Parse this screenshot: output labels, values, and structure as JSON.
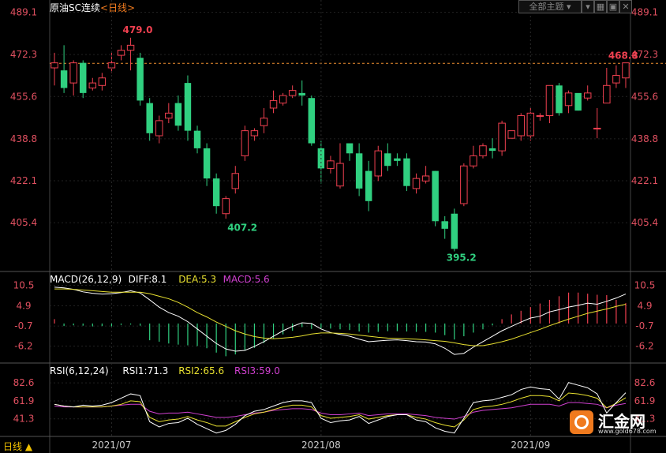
{
  "header": {
    "title": "原油SC连续",
    "period": "<日线>",
    "theme_button": "全部主题",
    "bottom_period": "日线 ▲"
  },
  "toolbar_icons": [
    "dropdown-icon",
    "grid-icon",
    "image-icon",
    "close-icon"
  ],
  "logo": {
    "text": "汇金网",
    "url": "www.gold678.com"
  },
  "chart_data": [
    {
      "type": "candlestick",
      "title": "原油SC连续 日线",
      "y_ticks": [
        "489.1",
        "472.3",
        "455.6",
        "438.8",
        "422.1",
        "405.4"
      ],
      "ylim": [
        386,
        494
      ],
      "x_ticks": [
        {
          "label": "2021/07",
          "index": 6
        },
        {
          "label": "2021/08",
          "index": 28
        },
        {
          "label": "2021/09",
          "index": 50
        }
      ],
      "last_price_line": 468.8,
      "annotations": [
        {
          "label": "479.0",
          "index": 7,
          "value": 479.0,
          "pos": "above"
        },
        {
          "label": "407.2",
          "index": 18,
          "value": 407.2,
          "pos": "below"
        },
        {
          "label": "395.2",
          "index": 41,
          "value": 395.2,
          "pos": "below"
        },
        {
          "label": "468.8",
          "index": 58,
          "value": 468.8,
          "pos": "above"
        }
      ],
      "candles": [
        [
          467,
          469,
          460,
          473
        ],
        [
          466,
          459,
          457,
          476
        ],
        [
          461,
          469,
          456,
          470
        ],
        [
          469,
          457,
          455,
          470
        ],
        [
          459,
          461,
          458,
          463
        ],
        [
          460,
          463,
          458,
          465
        ],
        [
          467,
          469,
          465,
          473
        ],
        [
          472,
          474,
          470,
          476
        ],
        [
          474,
          476,
          466,
          479
        ],
        [
          471,
          454,
          452,
          473
        ],
        [
          453,
          441,
          438,
          455
        ],
        [
          440,
          446,
          437,
          448
        ],
        [
          447,
          449,
          445,
          453
        ],
        [
          453,
          444,
          442,
          456
        ],
        [
          461,
          442,
          438,
          464
        ],
        [
          442,
          435,
          433,
          444
        ],
        [
          435,
          423,
          420,
          437
        ],
        [
          423,
          412,
          409,
          425
        ],
        [
          409,
          415,
          407,
          416
        ],
        [
          419,
          425,
          417,
          428
        ],
        [
          432,
          442,
          430,
          444
        ],
        [
          440,
          442,
          438,
          443
        ],
        [
          444,
          447,
          441,
          451
        ],
        [
          451,
          454,
          449,
          458
        ],
        [
          453,
          456,
          452,
          457
        ],
        [
          456,
          458,
          455,
          460
        ],
        [
          457,
          456,
          452,
          462
        ],
        [
          455,
          437,
          436,
          456
        ],
        [
          435,
          427,
          421,
          438
        ],
        [
          427,
          430,
          425,
          432
        ],
        [
          420,
          429,
          419,
          437
        ],
        [
          437,
          433,
          430,
          434
        ],
        [
          433,
          419,
          416,
          437
        ],
        [
          426,
          414,
          410,
          430
        ],
        [
          424,
          434,
          422,
          436
        ],
        [
          433,
          428,
          426,
          437
        ],
        [
          431,
          430,
          428,
          433
        ],
        [
          431,
          420,
          418,
          433
        ],
        [
          419,
          423,
          417,
          425
        ],
        [
          422,
          424,
          421,
          428
        ],
        [
          426,
          406,
          404,
          426
        ],
        [
          406,
          403,
          399,
          408
        ],
        [
          409,
          395,
          394,
          411
        ],
        [
          413,
          428,
          412,
          429
        ],
        [
          428,
          432,
          427,
          436
        ],
        [
          432,
          436,
          431,
          437
        ],
        [
          435,
          434,
          431,
          439
        ],
        [
          434,
          445,
          432,
          446
        ],
        [
          439,
          442,
          439,
          442
        ],
        [
          440,
          448,
          438,
          449
        ],
        [
          440,
          449,
          438,
          451
        ],
        [
          448,
          448,
          446,
          449
        ],
        [
          448,
          460,
          445,
          460
        ],
        [
          460,
          449,
          448,
          461
        ],
        [
          452,
          457,
          449,
          458
        ],
        [
          457,
          450,
          450,
          456
        ],
        [
          455,
          457,
          454,
          460
        ],
        [
          443,
          443,
          439,
          451
        ],
        [
          453,
          460,
          453,
          467
        ],
        [
          461,
          464,
          459,
          468
        ],
        [
          463,
          469,
          459,
          469
        ]
      ]
    },
    {
      "type": "macd",
      "title": "MACD(26,12,9)",
      "legend": [
        {
          "label": "DIFF:8.1",
          "color": "#ffffff"
        },
        {
          "label": "DEA:5.3",
          "color": "#e8e030"
        },
        {
          "label": "MACD:5.6",
          "color": "#d040d0"
        }
      ],
      "y_ticks": [
        "10.5",
        "4.9",
        "-0.7",
        "-6.2"
      ],
      "ylim": [
        -10,
        13
      ],
      "diff": [
        10,
        9.8,
        9.4,
        8.7,
        8.3,
        8.1,
        8.2,
        8.5,
        9,
        8.4,
        6.5,
        4.5,
        3,
        2,
        0.5,
        -1.5,
        -3.5,
        -5.5,
        -7,
        -7.6,
        -7.4,
        -6.3,
        -5,
        -3.5,
        -2,
        -0.8,
        0.2,
        0,
        -1.5,
        -2.5,
        -3,
        -3.5,
        -4.3,
        -5,
        -4.8,
        -4.6,
        -4.5,
        -4.7,
        -5,
        -5.1,
        -5.6,
        -6.8,
        -8.5,
        -8.2,
        -6.5,
        -5,
        -3.5,
        -2,
        -0.8,
        0.4,
        1.5,
        2,
        3.2,
        3.8,
        4.5,
        5,
        5.6,
        5.3,
        6.1,
        7,
        8.1
      ],
      "dea": [
        9.5,
        9.5,
        9.4,
        9.2,
        9,
        8.8,
        8.6,
        8.6,
        8.6,
        8.6,
        8.2,
        7.5,
        6.8,
        5.8,
        4.5,
        3,
        1.8,
        0.4,
        -0.8,
        -2,
        -2.9,
        -3.6,
        -4,
        -4.2,
        -4,
        -3.8,
        -3.4,
        -2.9,
        -2.6,
        -2.6,
        -2.7,
        -2.9,
        -3.2,
        -3.5,
        -3.8,
        -4,
        -4.1,
        -4.2,
        -4.3,
        -4.5,
        -4.7,
        -4.9,
        -5.3,
        -5.8,
        -6.1,
        -6.1,
        -5.6,
        -5,
        -4.3,
        -3.4,
        -2.5,
        -1.6,
        -0.6,
        0.3,
        1.2,
        2,
        2.8,
        3.4,
        4,
        4.7,
        5.3
      ],
      "macd": [
        1.2,
        -0.7,
        -0.5,
        -0.6,
        -0.8,
        -0.7,
        -0.8,
        -0.4,
        -0.3,
        -0.6,
        -4.6,
        -5,
        -5.5,
        -5.8,
        -6,
        -6.2,
        -6.8,
        -8,
        -9,
        -8.5,
        -7.3,
        -6.7,
        -5.4,
        -4.1,
        -3,
        -2,
        -1,
        -1.5,
        -1.3,
        -1.4,
        -1.6,
        -1.8,
        -2.2,
        -2.5,
        -2.3,
        -2.1,
        -2.1,
        -2.2,
        -2.3,
        -2.3,
        -2.5,
        -3.2,
        -4.4,
        -3.5,
        -2.5,
        -1.6,
        -0.5,
        1.2,
        2.5,
        3.5,
        4.5,
        5.5,
        6.5,
        7.5,
        8.5,
        8.5,
        8.2,
        7.9,
        7.8,
        6.5,
        5.6
      ]
    },
    {
      "type": "rsi",
      "title": "RSI(6,12,24)",
      "legend": [
        {
          "label": "RSI1:71.3",
          "color": "#ffffff"
        },
        {
          "label": "RSI2:65.6",
          "color": "#e8e030"
        },
        {
          "label": "RSI3:59.0",
          "color": "#d040d0"
        }
      ],
      "y_ticks": [
        "82.6",
        "61.9",
        "41.3"
      ],
      "ylim": [
        22,
        100
      ],
      "rsi1": [
        58,
        56,
        55,
        57,
        56,
        57,
        60,
        65,
        70,
        68,
        38,
        32,
        36,
        37,
        42,
        35,
        30,
        25,
        28,
        35,
        45,
        50,
        52,
        56,
        60,
        62,
        62,
        60,
        42,
        37,
        39,
        40,
        44,
        36,
        40,
        44,
        46,
        46,
        40,
        38,
        31,
        27,
        25,
        42,
        60,
        62,
        63,
        66,
        69,
        75,
        78,
        76,
        75,
        64,
        83,
        80,
        77,
        70,
        48,
        60,
        71.3
      ],
      "rsi2": [
        58,
        56,
        55,
        55,
        55,
        55,
        56,
        58,
        62,
        61,
        43,
        38,
        40,
        41,
        44,
        40,
        37,
        33,
        33,
        38,
        43,
        47,
        49,
        52,
        55,
        57,
        57,
        55,
        45,
        42,
        43,
        44,
        46,
        41,
        43,
        45,
        46,
        46,
        43,
        41,
        37,
        34,
        32,
        40,
        52,
        55,
        56,
        58,
        61,
        65,
        68,
        68,
        67,
        62,
        71,
        70,
        68,
        65,
        54,
        59,
        65.6
      ],
      "rsi3": [
        56,
        55,
        55,
        55,
        55,
        55,
        56,
        57,
        58,
        58,
        50,
        47,
        48,
        48,
        49,
        47,
        45,
        43,
        43,
        44,
        46,
        48,
        49,
        51,
        52,
        53,
        53,
        52,
        48,
        46,
        46,
        47,
        48,
        45,
        46,
        47,
        47,
        47,
        46,
        45,
        43,
        42,
        41,
        44,
        49,
        51,
        52,
        53,
        54,
        56,
        58,
        58,
        58,
        56,
        60,
        60,
        59,
        58,
        54,
        57,
        59
      ]
    }
  ]
}
